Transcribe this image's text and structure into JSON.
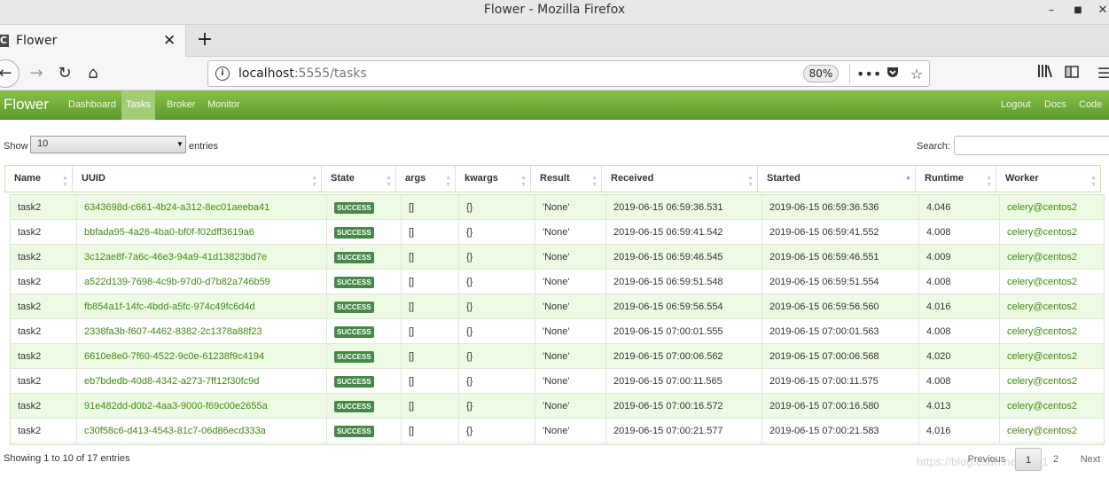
{
  "window": {
    "title": "Flower - Mozilla Firefox"
  },
  "tab": {
    "favicon": "C",
    "title": "Flower"
  },
  "address": {
    "host": "localhost",
    "rest": ":5555/tasks",
    "zoom": "80%"
  },
  "app": {
    "brand": "Flower",
    "nav": [
      "Dashboard",
      "Tasks",
      "Broker",
      "Monitor"
    ],
    "active_nav": "Tasks",
    "right_nav": [
      "Logout",
      "Docs",
      "Code"
    ],
    "accent_color": "#6aa83a"
  },
  "controls": {
    "show_label": "Show",
    "page_length": "10",
    "entries_label": "entries",
    "search_label": "Search:",
    "search_value": ""
  },
  "table": {
    "columns": [
      "Name",
      "UUID",
      "State",
      "args",
      "kwargs",
      "Result",
      "Received",
      "Started",
      "Runtime",
      "Worker"
    ],
    "sorted_column": "Started",
    "rows": [
      {
        "name": "task2",
        "uuid": "6343698d-c661-4b24-a312-8ec01aeeba41",
        "state": "SUCCESS",
        "args": "[]",
        "kwargs": "{}",
        "result": "'None'",
        "received": "2019-06-15 06:59:36.531",
        "started": "2019-06-15 06:59:36.536",
        "runtime": "4.046",
        "worker": "celery@centos2"
      },
      {
        "name": "task2",
        "uuid": "bbfada95-4a26-4ba0-bf0f-f02dff3619a6",
        "state": "SUCCESS",
        "args": "[]",
        "kwargs": "{}",
        "result": "'None'",
        "received": "2019-06-15 06:59:41.542",
        "started": "2019-06-15 06:59:41.552",
        "runtime": "4.008",
        "worker": "celery@centos2"
      },
      {
        "name": "task2",
        "uuid": "3c12ae8f-7a6c-46e3-94a9-41d13823bd7e",
        "state": "SUCCESS",
        "args": "[]",
        "kwargs": "{}",
        "result": "'None'",
        "received": "2019-06-15 06:59:46.545",
        "started": "2019-06-15 06:59:46.551",
        "runtime": "4.009",
        "worker": "celery@centos2"
      },
      {
        "name": "task2",
        "uuid": "a522d139-7698-4c9b-97d0-d7b82a746b59",
        "state": "SUCCESS",
        "args": "[]",
        "kwargs": "{}",
        "result": "'None'",
        "received": "2019-06-15 06:59:51.548",
        "started": "2019-06-15 06:59:51.554",
        "runtime": "4.008",
        "worker": "celery@centos2"
      },
      {
        "name": "task2",
        "uuid": "fb854a1f-14fc-4bdd-a5fc-974c49fc6d4d",
        "state": "SUCCESS",
        "args": "[]",
        "kwargs": "{}",
        "result": "'None'",
        "received": "2019-06-15 06:59:56.554",
        "started": "2019-06-15 06:59:56.560",
        "runtime": "4.016",
        "worker": "celery@centos2"
      },
      {
        "name": "task2",
        "uuid": "2338fa3b-f607-4462-8382-2c1378a88f23",
        "state": "SUCCESS",
        "args": "[]",
        "kwargs": "{}",
        "result": "'None'",
        "received": "2019-06-15 07:00:01.555",
        "started": "2019-06-15 07:00:01.563",
        "runtime": "4.008",
        "worker": "celery@centos2"
      },
      {
        "name": "task2",
        "uuid": "6610e8e0-7f60-4522-9c0e-61238f9c4194",
        "state": "SUCCESS",
        "args": "[]",
        "kwargs": "{}",
        "result": "'None'",
        "received": "2019-06-15 07:00:06.562",
        "started": "2019-06-15 07:00:06.568",
        "runtime": "4.020",
        "worker": "celery@centos2"
      },
      {
        "name": "task2",
        "uuid": "eb7bdedb-40d8-4342-a273-7ff12f30fc9d",
        "state": "SUCCESS",
        "args": "[]",
        "kwargs": "{}",
        "result": "'None'",
        "received": "2019-06-15 07:00:11.565",
        "started": "2019-06-15 07:00:11.575",
        "runtime": "4.008",
        "worker": "celery@centos2"
      },
      {
        "name": "task2",
        "uuid": "91e482dd-d0b2-4aa3-9000-f69c00e2655a",
        "state": "SUCCESS",
        "args": "[]",
        "kwargs": "{}",
        "result": "'None'",
        "received": "2019-06-15 07:00:16.572",
        "started": "2019-06-15 07:00:16.580",
        "runtime": "4.013",
        "worker": "celery@centos2"
      },
      {
        "name": "task2",
        "uuid": "c30f58c6-d413-4543-81c7-06d86ecd333a",
        "state": "SUCCESS",
        "args": "[]",
        "kwargs": "{}",
        "result": "'None'",
        "received": "2019-06-15 07:00:21.577",
        "started": "2019-06-15 07:00:21.583",
        "runtime": "4.016",
        "worker": "celery@centos2"
      }
    ]
  },
  "footer": {
    "info": "Showing 1 to 10 of 17 entries",
    "previous": "Previous",
    "pages": [
      "1",
      "2"
    ],
    "current_page": "1",
    "next": "Next",
    "watermark": "https://blog.csdn.net/u0_1"
  }
}
